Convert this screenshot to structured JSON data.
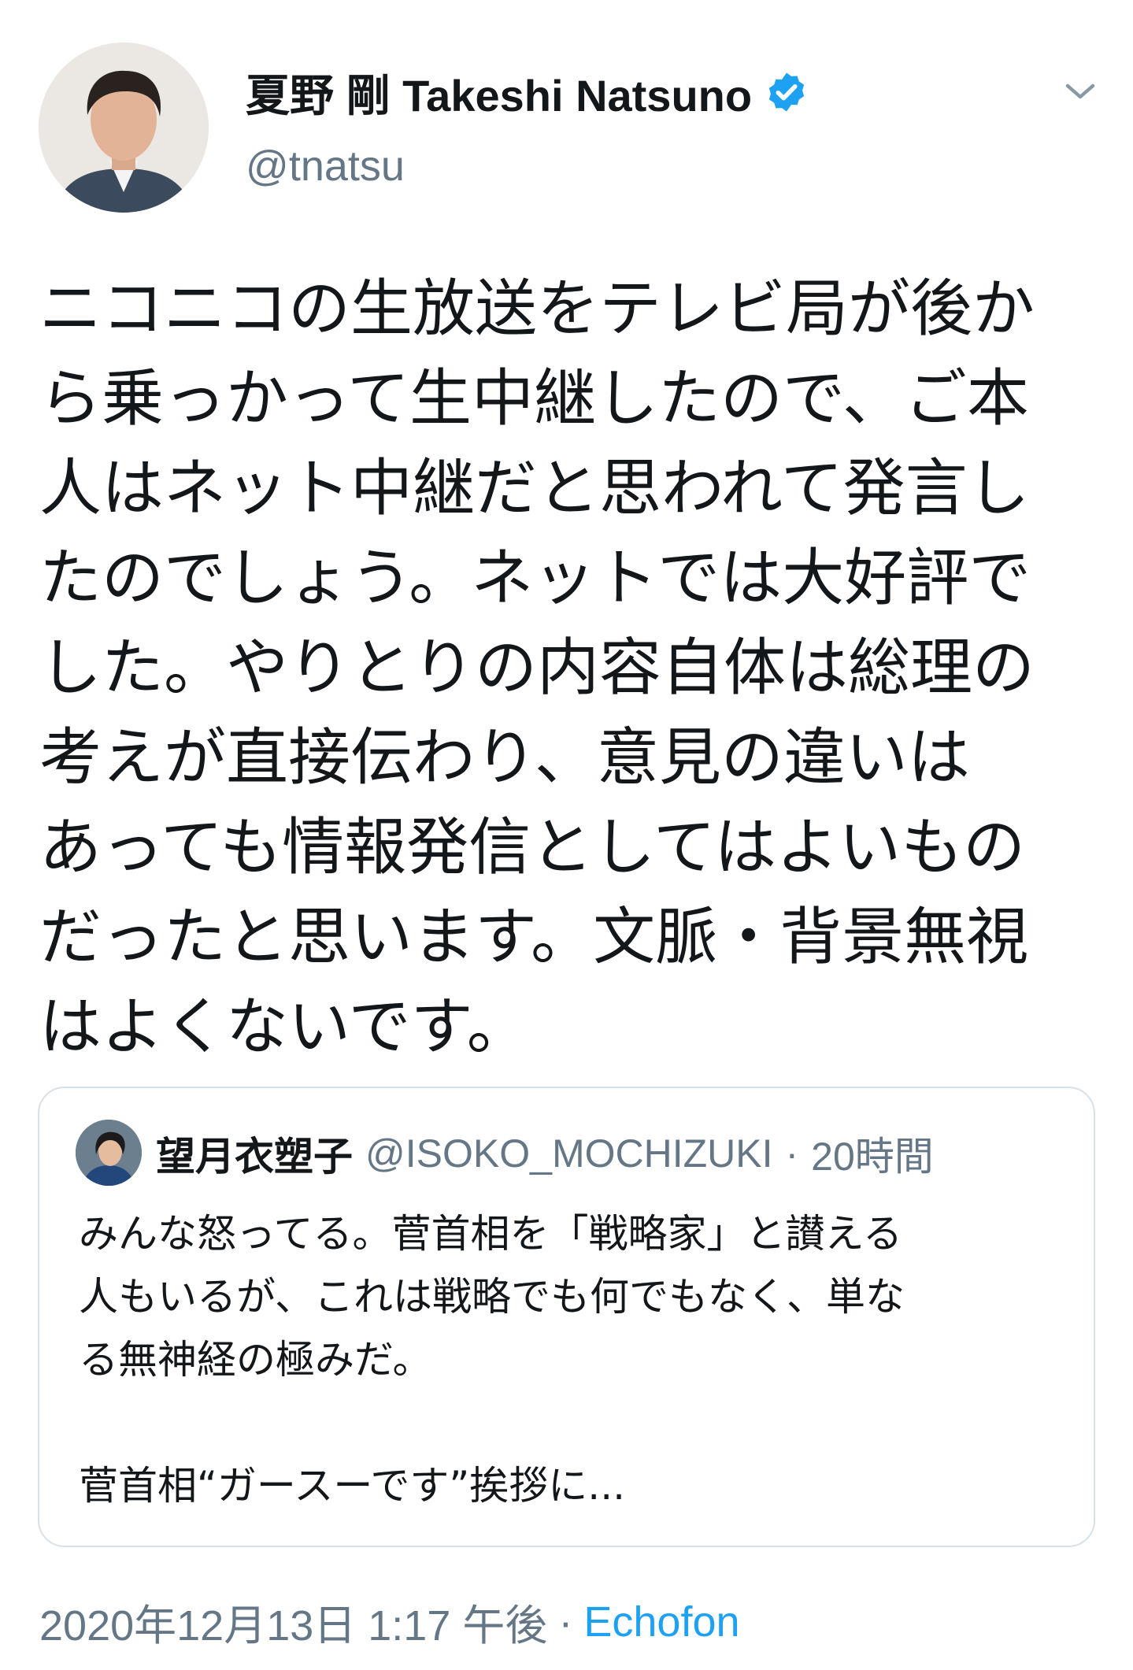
{
  "tweet": {
    "author_name": "夏野 剛 Takeshi Natsuno",
    "handle": "@tnatsu",
    "text": "ニコニコの生放送をテレビ局が後か\nら乗っかって生中継したので、ご本\n人はネット中継だと思われて発言し\nたのでしょう。ネットでは大好評で\nした。やりとりの内容自体は総理の\n考えが直接伝わり、意見の違いは\nあっても情報発信としてはよいもの\nだったと思います。文脈・背景無視\nはよくないです。",
    "date": "2020年12月13日 1:17 午後",
    "separator": "·",
    "source": "Echofon"
  },
  "quoted_tweet": {
    "author_name": "望月衣塑子",
    "handle": "@ISOKO_MOCHIZUKI",
    "separator": "·",
    "time": "20時間",
    "text": "みんな怒ってる。菅首相を「戦略家」と讃える\n人もいるが、これは戦略でも何でもなく、単な\nる無神経の極みだ。\n\n菅首相“ガースーです”挨拶に..."
  },
  "icons": {
    "verified": "verified-badge-icon",
    "menu": "chevron-down-icon"
  },
  "colors": {
    "text": "#14171a",
    "secondary": "#657786",
    "link": "#1da1f2",
    "verified": "#1da1f2",
    "border": "#d9e1e8"
  }
}
